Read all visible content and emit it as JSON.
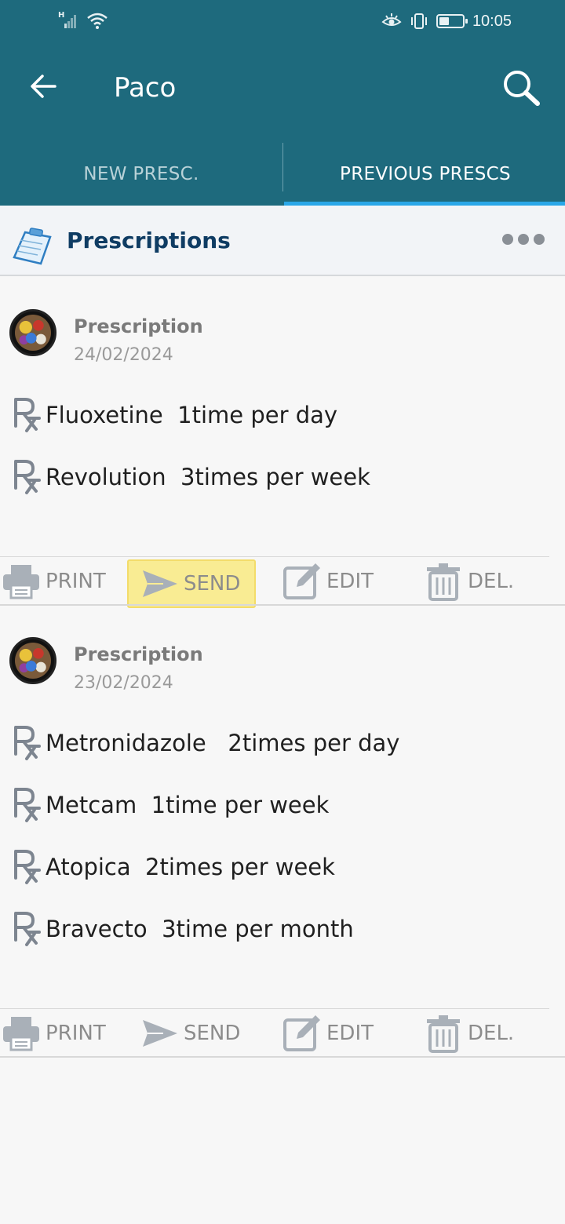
{
  "status_bar": {
    "network_label": "H",
    "time": "10:05",
    "icons": [
      "signal-icon",
      "wifi-icon",
      "eye-comfort-icon",
      "vibrate-icon",
      "battery-icon"
    ]
  },
  "app_bar": {
    "title": "Paco",
    "back_icon": "arrow-left-icon",
    "search_icon": "search-icon"
  },
  "tabs": [
    {
      "label": "NEW PRESC.",
      "selected": false
    },
    {
      "label": "PREVIOUS PRESCS",
      "selected": true
    }
  ],
  "section": {
    "title": "Prescriptions",
    "icon": "clipboard-icon",
    "menu_icon": "more-horizontal-icon"
  },
  "prescriptions": [
    {
      "title": "Prescription",
      "date": "24/02/2024",
      "items": [
        {
          "drug": "Fluoxetine",
          "dosage": "1time per day",
          "text": "Fluoxetine  1time per day"
        },
        {
          "drug": "Revolution",
          "dosage": "3times per week",
          "text": "Revolution  3times per week"
        }
      ],
      "actions": {
        "print": "PRINT",
        "send": "SEND",
        "edit": "EDIT",
        "delete": "DEL."
      },
      "send_highlighted": true
    },
    {
      "title": "Prescription",
      "date": "23/02/2024",
      "items": [
        {
          "drug": "Metronidazole",
          "dosage": "2times per day",
          "text": "Metronidazole   2times per day"
        },
        {
          "drug": "Metcam",
          "dosage": "1time per week",
          "text": "Metcam  1time per week"
        },
        {
          "drug": "Atopica",
          "dosage": "2times per week",
          "text": "Atopica  2times per week"
        },
        {
          "drug": "Bravecto",
          "dosage": "3time per month",
          "text": "Bravecto  3time per month"
        }
      ],
      "actions": {
        "print": "PRINT",
        "send": "SEND",
        "edit": "EDIT",
        "delete": "DEL."
      },
      "send_highlighted": false
    }
  ],
  "colors": {
    "app_bar": "#1e6a7d",
    "tab_indicator": "#2aa7e8",
    "section_title": "#0f3c63",
    "highlight": "#f9ec93"
  }
}
